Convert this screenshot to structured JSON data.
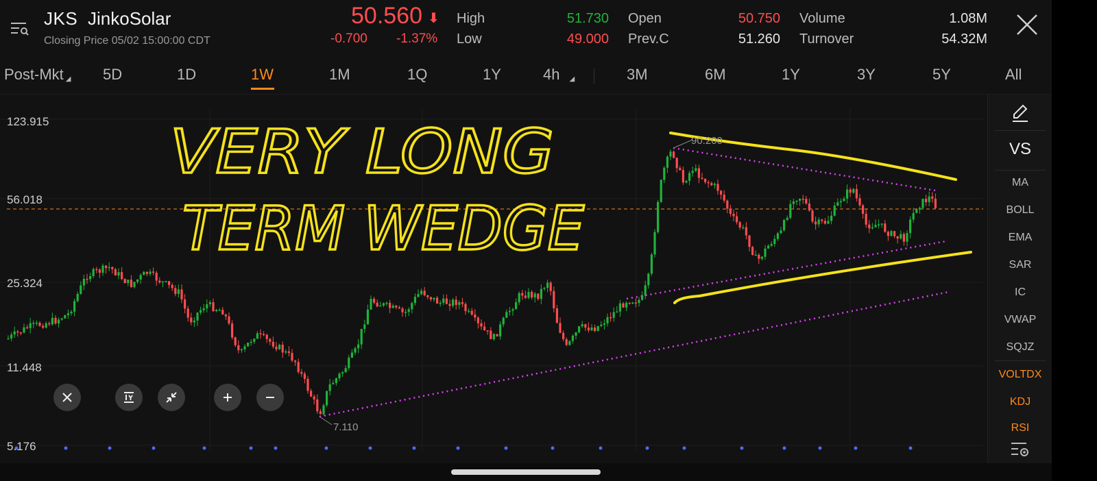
{
  "header": {
    "symbol": "JKS",
    "name": "JinkoSolar",
    "closing_label": "Closing Price  05/02 15:00:00 CDT",
    "price": "50.560",
    "change": "-0.700",
    "change_pct": "-1.37%",
    "stats": {
      "high_label": "High",
      "high": "51.730",
      "low_label": "Low",
      "low": "49.000",
      "open_label": "Open",
      "open": "50.750",
      "prevc_label": "Prev.C",
      "prevc": "51.260",
      "volume_label": "Volume",
      "volume": "1.08M",
      "turnover_label": "Turnover",
      "turnover": "54.32M"
    }
  },
  "tabs": {
    "postmkt": "Post-Mkt",
    "d5": "5D",
    "d1": "1D",
    "w1": "1W",
    "m1": "1M",
    "q1": "1Q",
    "y1": "1Y",
    "h4": "4h",
    "m3": "3M",
    "m6": "6M",
    "y1b": "1Y",
    "y3": "3Y",
    "y5": "5Y",
    "all": "All"
  },
  "chart": {
    "y_labels": [
      "123.915",
      "56.018",
      "25.324",
      "11.448",
      "5.176"
    ],
    "high_marker": "90.200",
    "low_marker": "7.110",
    "annotation_line1": "VERY LONG",
    "annotation_line2": "TERM WEDGE"
  },
  "indicators": {
    "vs": "VS",
    "items": [
      "MA",
      "BOLL",
      "EMA",
      "SAR",
      "IC",
      "VWAP",
      "SQJZ"
    ],
    "orange_items": [
      "VOLTDX",
      "KDJ",
      "RSI"
    ]
  },
  "colors": {
    "up": "#1fb33a",
    "down": "#ff4d4f",
    "accent": "#ff8a1a",
    "annotation": "#f5e21b",
    "trendline": "#e040fb"
  }
}
